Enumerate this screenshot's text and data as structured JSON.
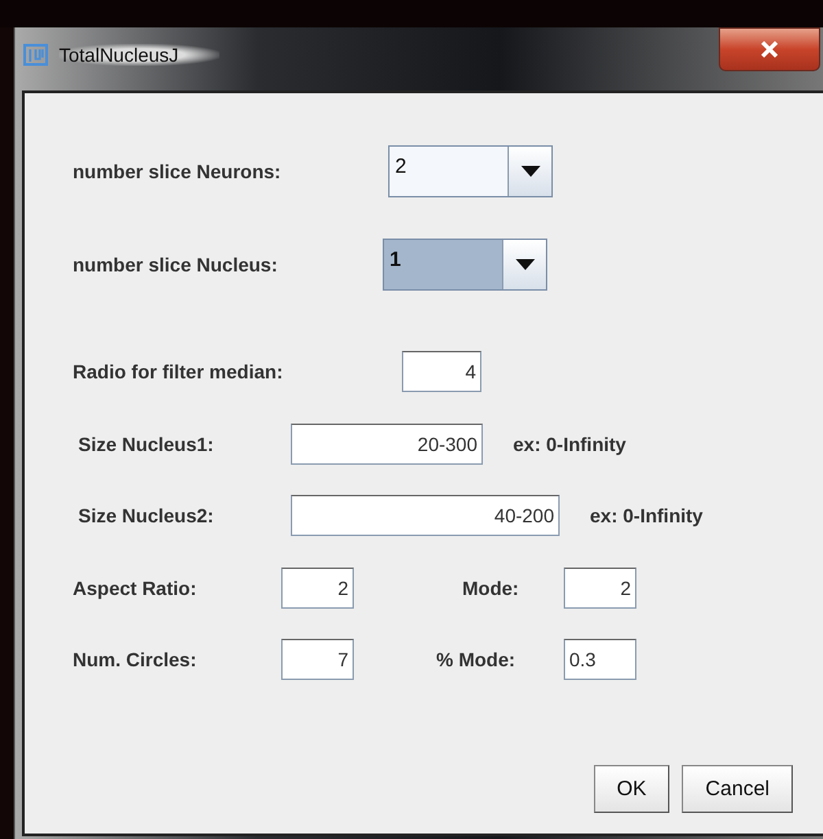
{
  "window": {
    "title": "TotalNucleusJ"
  },
  "rows": [
    {
      "kind": "combo",
      "label": "number slice Neurons:",
      "value": "2",
      "selected": false
    },
    {
      "kind": "combo",
      "label": "number slice Nucleus:",
      "value": "1",
      "selected": true
    },
    {
      "kind": "text",
      "label": "Radio for filter median:",
      "value": "4",
      "left_aligned": false
    },
    {
      "kind": "text",
      "label": "Size Nucleus1:",
      "value": "20-300",
      "left_aligned": false,
      "hint": "ex: 0-Infinity"
    },
    {
      "kind": "text",
      "label": "Size Nucleus2:",
      "value": "40-200",
      "left_aligned": false,
      "hint": "ex: 0-Infinity"
    },
    {
      "kind": "pair",
      "items": [
        {
          "label": "Aspect Ratio:",
          "value": "2",
          "left_aligned": false
        },
        {
          "label": "Mode:",
          "value": "2",
          "left_aligned": false
        }
      ]
    },
    {
      "kind": "pair",
      "items": [
        {
          "label": "Num. Circles:",
          "value": "7",
          "left_aligned": false
        },
        {
          "label": "% Mode:",
          "value": "0.3",
          "left_aligned": true
        }
      ]
    }
  ],
  "buttons": [
    "OK",
    "Cancel"
  ]
}
